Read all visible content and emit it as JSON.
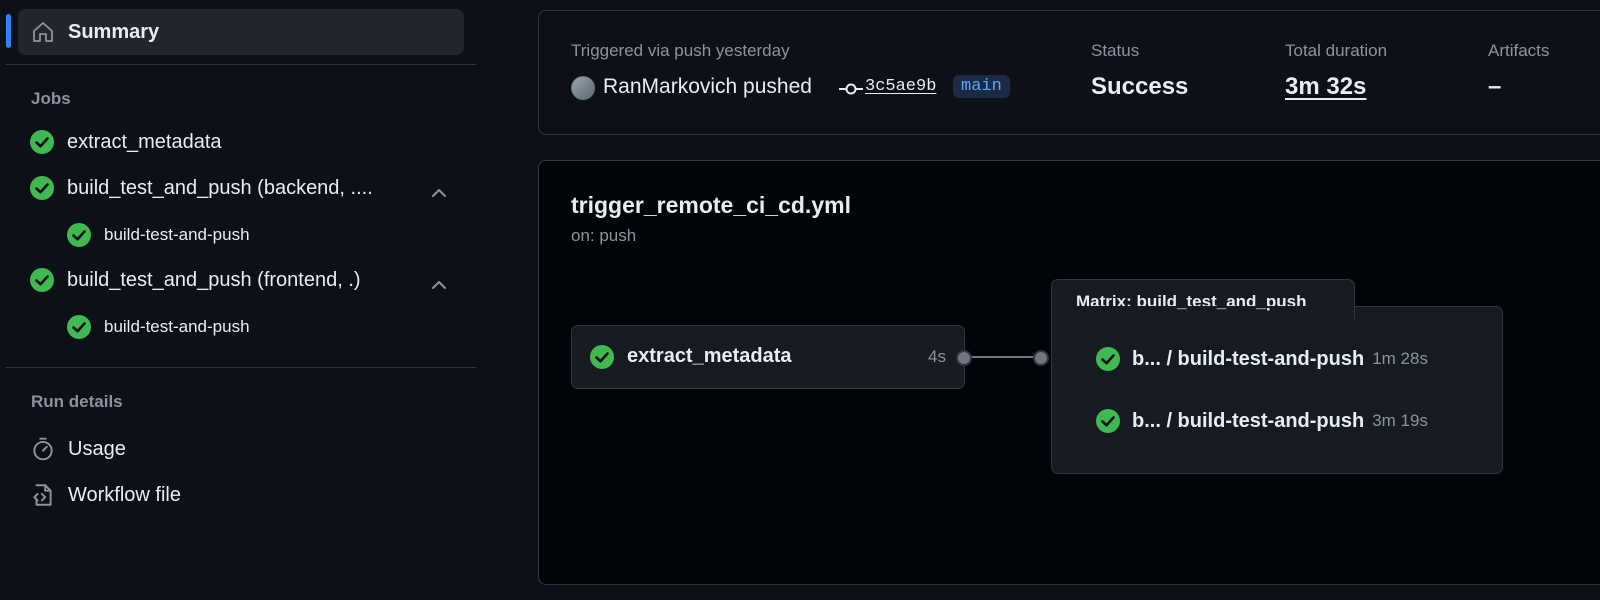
{
  "sidebar": {
    "summary_label": "Summary",
    "jobs_heading": "Jobs",
    "jobs": [
      {
        "label": "extract_metadata"
      },
      {
        "label": "build_test_and_push (backend, ....",
        "sub": "build-test-and-push"
      },
      {
        "label": "build_test_and_push (frontend, .)",
        "sub": "build-test-and-push"
      }
    ],
    "run_details_heading": "Run details",
    "usage_label": "Usage",
    "workflow_file_label": "Workflow file"
  },
  "run": {
    "trigger_text": "Triggered via push yesterday",
    "pusher": "RanMarkovich pushed",
    "commit": "3c5ae9b",
    "branch": "main",
    "status_label": "Status",
    "status_value": "Success",
    "duration_label": "Total duration",
    "duration_value": "3m 32s",
    "artifacts_label": "Artifacts",
    "artifacts_value": "–"
  },
  "graph": {
    "workflow_name": "trigger_remote_ci_cd.yml",
    "trigger": "on: push",
    "job": {
      "name": "extract_metadata",
      "time": "4s"
    },
    "matrix_title": "Matrix: build_test_and_push",
    "matrix_jobs": [
      {
        "name": "b... / build-test-and-push",
        "time": "1m 28s"
      },
      {
        "name": "b... / build-test-and-push",
        "time": "3m 19s"
      }
    ]
  },
  "colors": {
    "background": "#0d1117",
    "success": "#3fb950",
    "accent": "#2f81f7",
    "branch": "#58a6ff"
  }
}
